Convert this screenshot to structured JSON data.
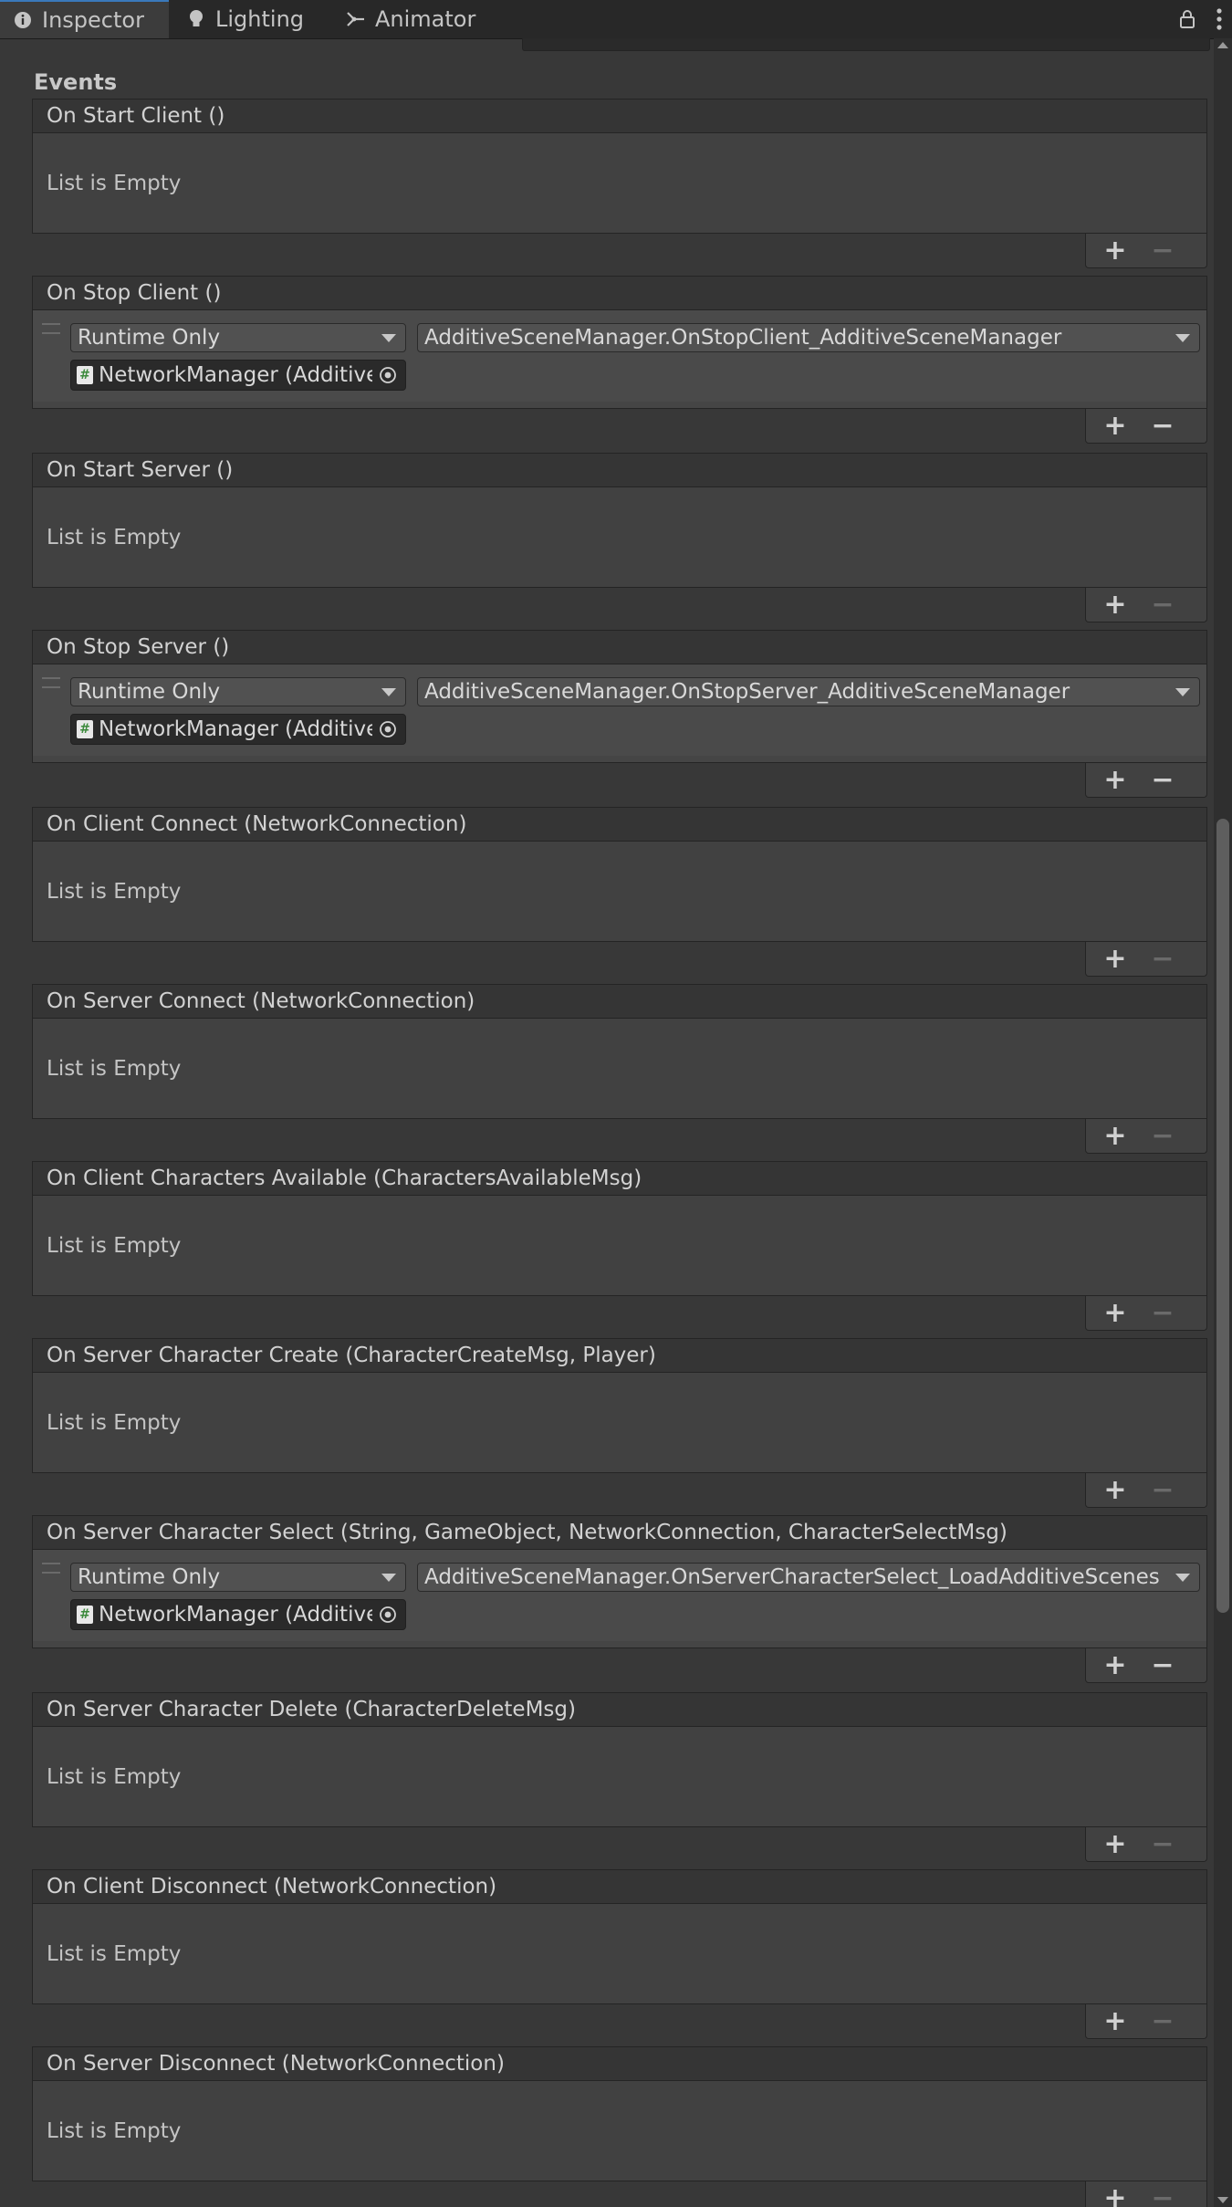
{
  "tabs": [
    {
      "label": "Inspector",
      "icon": "info-icon",
      "active": true
    },
    {
      "label": "Lighting",
      "icon": "lightbulb-icon",
      "active": false
    },
    {
      "label": "Animator",
      "icon": "animator-icon",
      "active": false
    }
  ],
  "section_title": "Events",
  "empty_text": "List is Empty",
  "events": [
    {
      "title": "On Start Client ()",
      "filled": false
    },
    {
      "title": "On Stop Client ()",
      "filled": true,
      "runtime": "Runtime Only",
      "method": "AdditiveSceneManager.OnStopClient_AdditiveSceneManager",
      "object": "NetworkManager (Additive"
    },
    {
      "title": "On Start Server ()",
      "filled": false
    },
    {
      "title": "On Stop Server ()",
      "filled": true,
      "runtime": "Runtime Only",
      "method": "AdditiveSceneManager.OnStopServer_AdditiveSceneManager",
      "object": "NetworkManager (Additive"
    },
    {
      "title": "On Client Connect (NetworkConnection)",
      "filled": false
    },
    {
      "title": "On Server Connect (NetworkConnection)",
      "filled": false
    },
    {
      "title": "On Client Characters Available (CharactersAvailableMsg)",
      "filled": false
    },
    {
      "title": "On Server Character Create (CharacterCreateMsg, Player)",
      "filled": false
    },
    {
      "title": "On Server Character Select (String, GameObject, NetworkConnection, CharacterSelectMsg)",
      "filled": true,
      "runtime": "Runtime Only",
      "method": "AdditiveSceneManager.OnServerCharacterSelect_LoadAdditiveScenes",
      "object": "NetworkManager (Additive"
    },
    {
      "title": "On Server Character Delete (CharacterDeleteMsg)",
      "filled": false
    },
    {
      "title": "On Client Disconnect (NetworkConnection)",
      "filled": false
    },
    {
      "title": "On Server Disconnect (NetworkConnection)",
      "filled": false
    }
  ],
  "footer": {
    "plus": "+",
    "minus": "−"
  },
  "colors": {
    "background": "#383838",
    "tab_active_accent": "#3a79bb",
    "script_icon": "#3c8a3c"
  }
}
